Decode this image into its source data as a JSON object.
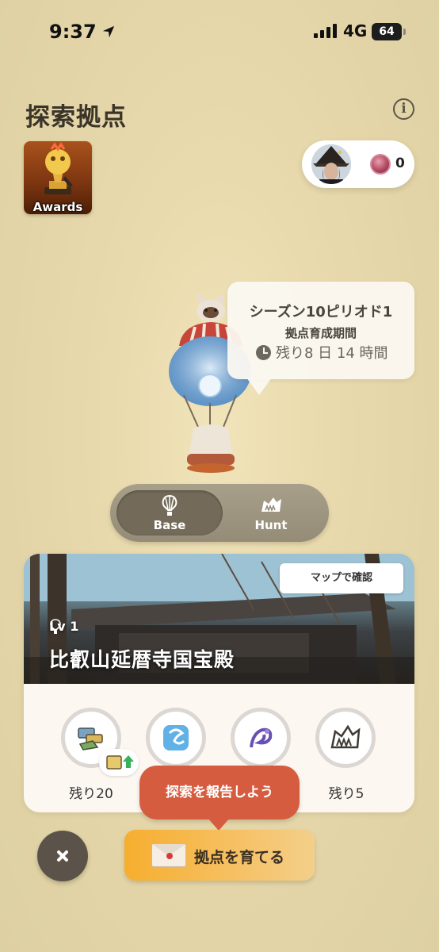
{
  "status_bar": {
    "time": "9:37",
    "network": "4G",
    "battery": "64"
  },
  "header": {
    "title": "探索拠点",
    "info_icon": "info-icon"
  },
  "awards": {
    "label": "Awards"
  },
  "profile": {
    "coin_count": "0"
  },
  "season": {
    "title": "シーズン10ピリオド1",
    "subtitle": "拠点育成期間",
    "remaining": "残り8 日 14 時間"
  },
  "mode_toggle": {
    "options": [
      {
        "label": "Base",
        "icon": "balloon-icon",
        "selected": true
      },
      {
        "label": "Hunt",
        "icon": "monster-icon",
        "selected": false
      }
    ]
  },
  "base_card": {
    "map_button": "マップで確認",
    "level": "Lv 1",
    "name": "比叡山延暦寺国宝殿",
    "items": [
      {
        "icon": "materials-icon",
        "remaining": "残り20"
      },
      {
        "icon": "wind-monster-icon",
        "remaining": ""
      },
      {
        "icon": "dragon-monster-icon",
        "remaining": ""
      },
      {
        "icon": "fanged-monster-icon",
        "remaining": "残り5"
      }
    ]
  },
  "report_bubble": "探索を報告しよう",
  "actions": {
    "grow_button": "拠点を育てる"
  },
  "colors": {
    "background": "#e9daad",
    "accent_orange": "#f6ae2e",
    "report_red": "#d65c3f"
  }
}
